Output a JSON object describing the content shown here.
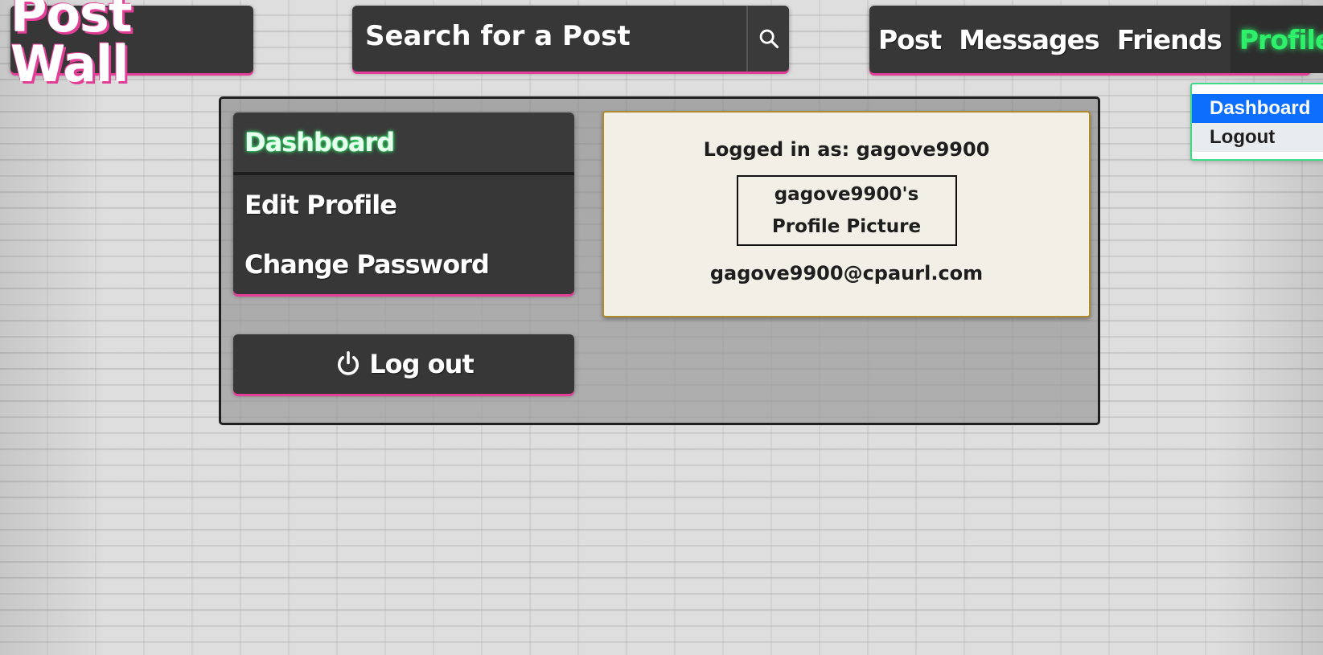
{
  "header": {
    "logo_text": "Post Wall",
    "search": {
      "placeholder": "Search for a Post"
    },
    "nav": {
      "items": [
        {
          "label": "Post"
        },
        {
          "label": "Messages"
        },
        {
          "label": "Friends"
        },
        {
          "label": "Profile",
          "active": true
        }
      ]
    },
    "dropdown": {
      "items": [
        {
          "label": "Dashboard",
          "active": true
        },
        {
          "label": "Logout"
        }
      ]
    }
  },
  "sidebar": {
    "items": [
      {
        "label": "Dashboard",
        "active": true
      },
      {
        "label": "Edit Profile"
      },
      {
        "label": "Change Password"
      }
    ],
    "logout_label": "Log out"
  },
  "profile": {
    "logged_in_text": "Logged in as: gagove9900",
    "picture_alt": "gagove9900's Profile Picture",
    "email": "gagove9900@cpaurl.com"
  },
  "colors": {
    "accent_pink": "#e23e97",
    "active_green": "#2ff06a",
    "panel_dark": "#373737",
    "dropdown_active": "#0d6efd"
  },
  "icons": {
    "search": "search-icon",
    "logout": "power-icon"
  }
}
